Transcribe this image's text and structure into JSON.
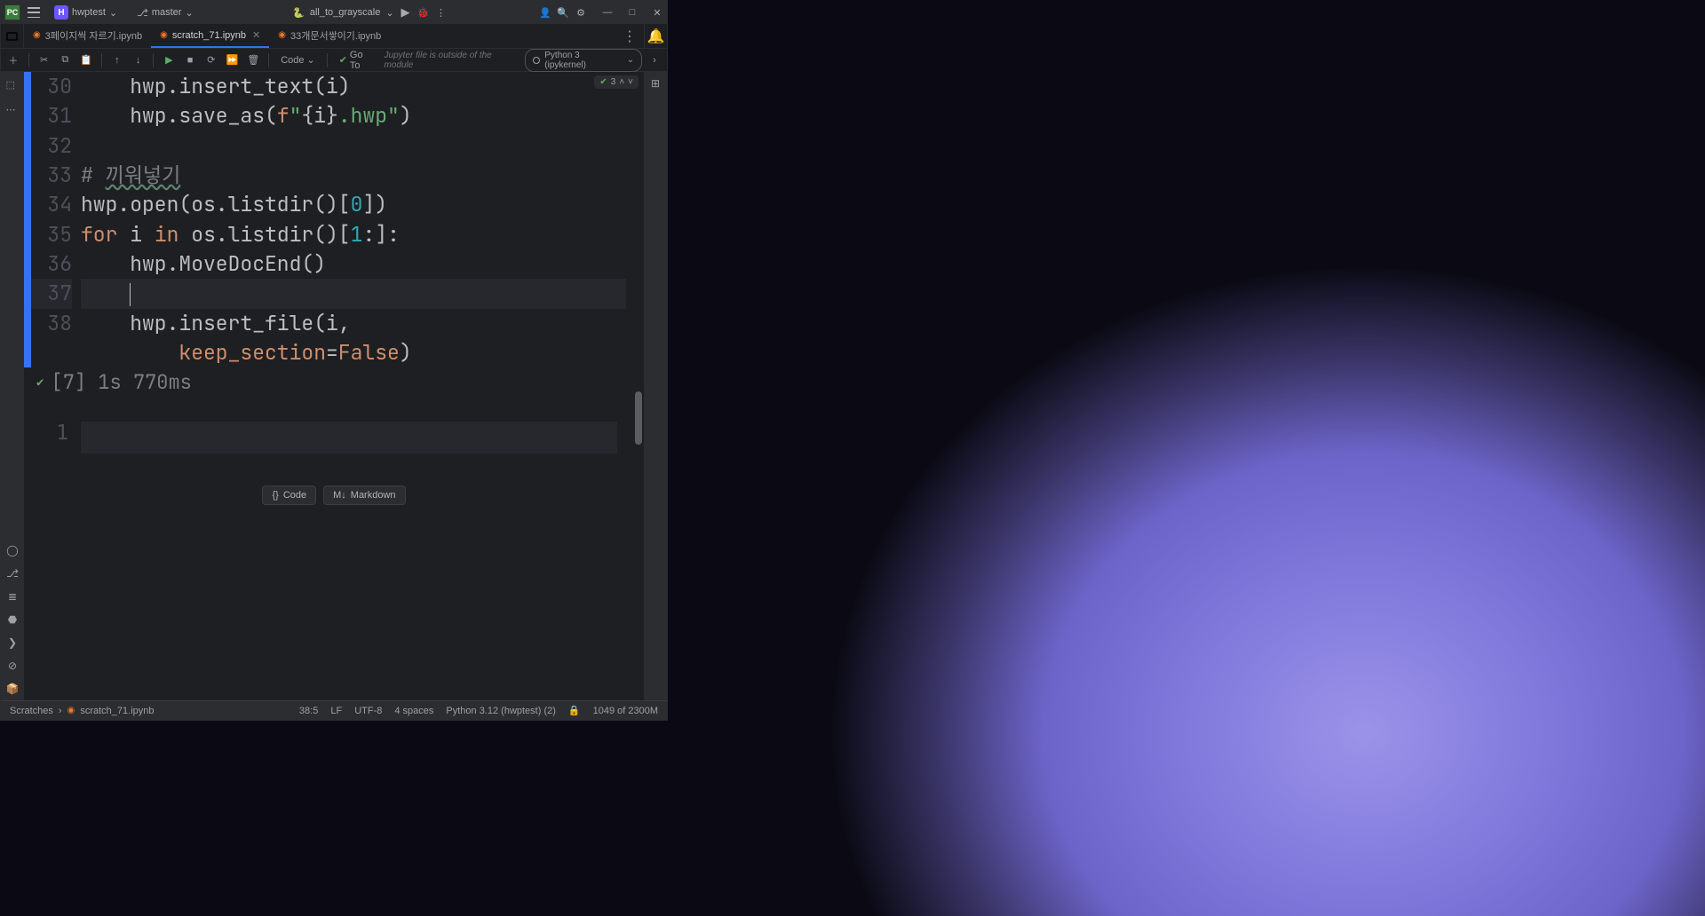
{
  "titleBar": {
    "project": "hwptest",
    "branch": "master",
    "runConfig": "all_to_grayscale"
  },
  "tabs": [
    {
      "label": "3페이지씩 자르기.ipynb",
      "active": false
    },
    {
      "label": "scratch_71.ipynb",
      "active": true
    },
    {
      "label": "33개문서쌓이기.ipynb",
      "active": false
    }
  ],
  "toolbar": {
    "codeLabel": "Code",
    "gotoLabel": "Go To",
    "hint": "Jupyter file is outside of the module",
    "kernel": "Python 3 (ipykernel)"
  },
  "problemsCount": "3",
  "code": {
    "lines": [
      {
        "n": "30",
        "html": "    <span class='tok-id'>hwp.insert_text(i)</span>"
      },
      {
        "n": "31",
        "html": "    <span class='tok-id'>hwp.save_as(</span><span class='tok-kw'>f</span><span class='tok-str'>\"</span>{i}<span class='tok-str'>.hwp\"</span><span class='tok-id'>)</span>"
      },
      {
        "n": "32",
        "html": ""
      },
      {
        "n": "33",
        "html": "<span class='tok-cm'># </span><span class='tok-cm tok-cm-u'>끼워넣기</span>"
      },
      {
        "n": "34",
        "html": "<span class='tok-id'>hwp.open(os.listdir()[</span><span class='tok-num'>0</span><span class='tok-id'>])</span>"
      },
      {
        "n": "35",
        "html": "<span class='tok-kw'>for</span> <span class='tok-id'>i</span> <span class='tok-kw'>in</span> <span class='tok-id'>os.listdir()[</span><span class='tok-num'>1</span><span class='tok-id'>:]:</span>"
      },
      {
        "n": "36",
        "html": "    <span class='tok-id'>hwp.MoveDocEnd()</span>"
      },
      {
        "n": "37",
        "html": "    ",
        "cursor": true
      },
      {
        "n": "38",
        "html": "    <span class='tok-id'>hwp.insert_file(i,</span>\n        <span class='tok-param'>keep_section</span><span class='tok-id'>=</span><span class='tok-kw'>False</span><span class='tok-id'>)</span>"
      }
    ],
    "exec": "[7] 1s 770ms",
    "emptyCellNumber": "1"
  },
  "addButtons": {
    "code": "Code",
    "markdown": "Markdown"
  },
  "breadcrumb": {
    "root": "Scratches",
    "file": "scratch_71.ipynb"
  },
  "status": {
    "pos": "38:5",
    "lineEnding": "LF",
    "encoding": "UTF-8",
    "indent": "4 spaces",
    "interpreter": "Python 3.12 (hwptest) (2)",
    "memory": "1049 of 2300M"
  }
}
